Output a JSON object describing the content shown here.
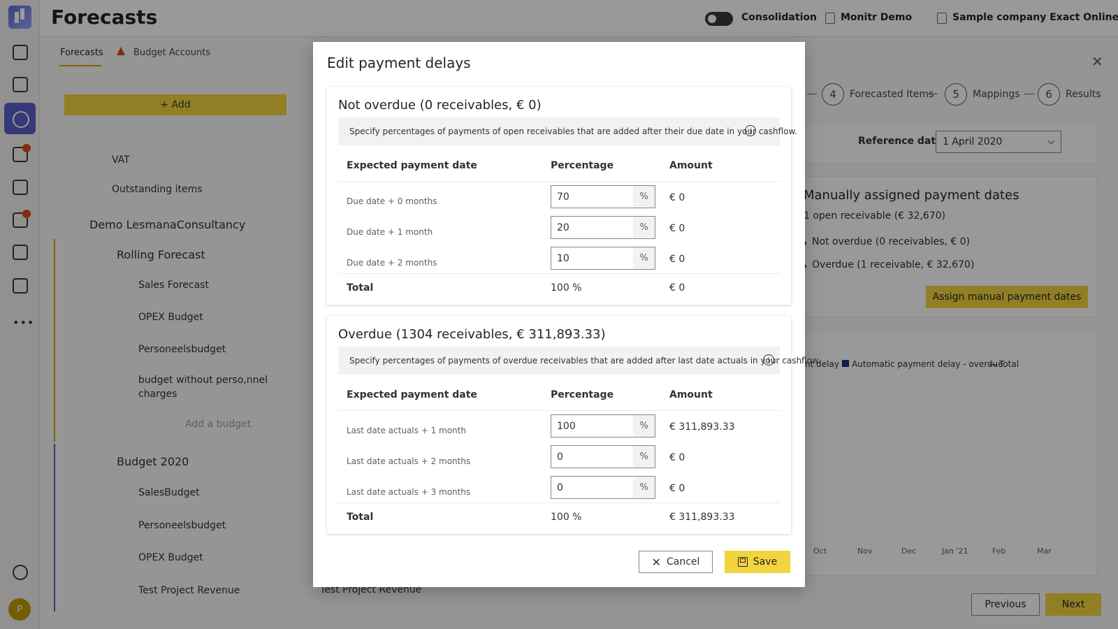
{
  "app": {
    "page_title": "Forecasts",
    "consolidation_label": "Consolidation",
    "org_label": "Monitr Demo",
    "company_label": "Sample company Exact Online",
    "user_initial": "P"
  },
  "tabs": [
    {
      "label": "Forecasts"
    },
    {
      "label": "Budget Accounts"
    }
  ],
  "left": {
    "add_label": "Add",
    "items": [
      {
        "label": "VAT"
      },
      {
        "label": "Outstanding items"
      },
      {
        "label": "Demo LesmanaConsultancy"
      },
      {
        "label": "Rolling Forecast"
      },
      {
        "label": "Sales Forecast"
      },
      {
        "label": "OPEX Budget"
      },
      {
        "label": "Personeelsbudget"
      },
      {
        "label": "budget without perso,nnel"
      },
      {
        "label": "charges"
      },
      {
        "label": "Add a budget"
      },
      {
        "label": "Budget 2020"
      },
      {
        "label": "SalesBudget"
      },
      {
        "label": "Personeelsbudget"
      },
      {
        "label": "OPEX Budget"
      },
      {
        "label": "Test Project Revenue"
      }
    ]
  },
  "right": {
    "steps": [
      {
        "num": "4",
        "label": "Forecasted Items"
      },
      {
        "num": "5",
        "label": "Mappings"
      },
      {
        "num": "6",
        "label": "Results"
      }
    ],
    "reference_date_label": "Reference date",
    "reference_date_value": "1 April 2020",
    "manual_title": "Manually assigned payment dates",
    "manual_sub": "1 open receivable (€ 32,670)",
    "bullets": [
      "Not overdue (0 receivables, € 0)",
      "Overdue (1 receivable, € 32,670)"
    ],
    "assign_label": "Assign manual payment dates",
    "legend": [
      "nt delay",
      "Automatic payment delay - overdue",
      "Total"
    ],
    "months": [
      "Oct",
      "Nov",
      "Dec",
      "Jan '21",
      "Feb",
      "Mar"
    ],
    "prev_label": "Previous",
    "next_label": "Next",
    "behind_item": "Test Project Revenue"
  },
  "modal": {
    "title": "Edit payment delays",
    "cancel_label": "Cancel",
    "save_label": "Save",
    "sections": [
      {
        "title": "Not overdue (0 receivables, € 0)",
        "info": "Specify percentages of payments of open receivables that are added after their due date in your cashflow.",
        "col_date": "Expected payment date",
        "col_pct": "Percentage",
        "col_amount": "Amount",
        "rows": [
          {
            "label": "Due date + 0 months",
            "value": "70",
            "amount": "€ 0"
          },
          {
            "label": "Due date + 1 month",
            "value": "20",
            "amount": "€ 0"
          },
          {
            "label": "Due date + 2 months",
            "value": "10",
            "amount": "€ 0"
          }
        ],
        "total_label": "Total",
        "total_pct": "100 %",
        "total_amount": "€ 0"
      },
      {
        "title": "Overdue (1304 receivables, € 311,893.33)",
        "info": "Specify percentages of payments of overdue receivables that are added after last date actuals in your cashflow.",
        "col_date": "Expected payment date",
        "col_pct": "Percentage",
        "col_amount": "Amount",
        "rows": [
          {
            "label": "Last date actuals + 1 month",
            "value": "100",
            "amount": "€ 311,893.33"
          },
          {
            "label": "Last date actuals + 2 months",
            "value": "0",
            "amount": "€ 0"
          },
          {
            "label": "Last date actuals + 3 months",
            "value": "0",
            "amount": "€ 0"
          }
        ],
        "total_label": "Total",
        "total_pct": "100 %",
        "total_amount": "€ 311,893.33"
      }
    ],
    "pct_suffix": "%"
  },
  "colors": {
    "accent": "#f2d440",
    "brand": "#5b5fc7",
    "alert": "#d64d17"
  }
}
